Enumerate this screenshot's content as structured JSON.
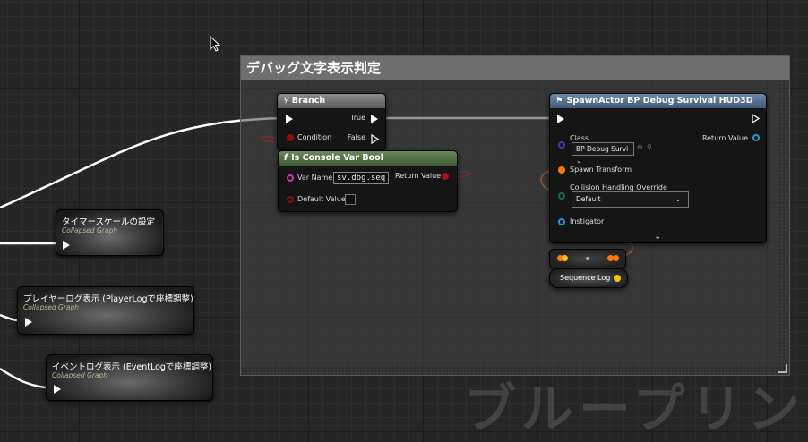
{
  "comment": {
    "title": "デバッグ文字表示判定"
  },
  "branch": {
    "title": "Branch",
    "true_label": "True",
    "false_label": "False",
    "condition_label": "Condition"
  },
  "console_var": {
    "title": "Is Console Var Bool",
    "var_name_label": "Var Name",
    "var_name_value": "sv.dbg.seq",
    "return_label": "Return Value",
    "default_label": "Default Value"
  },
  "spawn_actor": {
    "title": "SpawnActor BP Debug Survival HUD3D",
    "class_label": "Class",
    "class_value": "BP Debug Survi",
    "return_label": "Return Value",
    "spawn_transform_label": "Spawn Transform",
    "collision_label": "Collision Handling Override",
    "collision_value": "Default",
    "instigator_label": "Instigator"
  },
  "sequence_log": {
    "title": "Sequence Log"
  },
  "collapsed_graphs": [
    {
      "title": "タイマースケールの設定",
      "subtitle": "Collapsed Graph"
    },
    {
      "title": "プレイヤーログ表示 (PlayerLogで座標調整)",
      "subtitle": "Collapsed Graph"
    },
    {
      "title": "イベントログ表示 (EventLogで座標調整)",
      "subtitle": "Collapsed Graph"
    }
  ],
  "watermark": "ブループリント",
  "colors": {
    "exec": "#ffffff",
    "bool_pin": "#8e0c0c",
    "string_pin": "#d42fb8",
    "class_pin": "#5d2aa8",
    "struct_pin": "#ff7a00",
    "object_pin": "#1e9bd6",
    "int_pin": "#f7c11b"
  }
}
